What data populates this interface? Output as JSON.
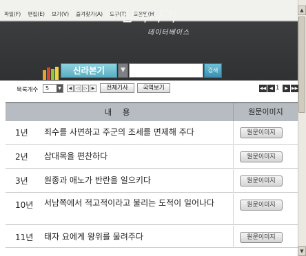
{
  "menubar": {
    "items": [
      "파일(F)",
      "편집(E)",
      "보기(V)",
      "즐겨찾기(A)",
      "도구(T)",
      "도움말(H)"
    ]
  },
  "banner": {
    "title": "삼국사기",
    "subtitle": "데이터베이스"
  },
  "search": {
    "category": "신라본기",
    "value": "",
    "button_label": "검색"
  },
  "toolbar": {
    "count_label": "목록개수",
    "count_value": "5",
    "full_label": "전체기사",
    "translation_label": "국역보기",
    "page": "1"
  },
  "table": {
    "header_content": "내 용",
    "header_image": "원문이미지",
    "image_button_label": "원문이미지",
    "rows": [
      {
        "year": "1년",
        "text": "죄수를 사면하고 주군의 조세를 면제해 주다"
      },
      {
        "year": "2년",
        "text": "삼대목을 편찬하다"
      },
      {
        "year": "3년",
        "text": "원종과 애노가 반란을 일으키다"
      },
      {
        "year": "10년",
        "text": "서남쪽에서 적고적이라고 불리는 도적이 일어나다"
      },
      {
        "year": "11년",
        "text": "태자 요에게 왕위를 물려주다"
      }
    ]
  },
  "colors": {
    "banner": "#2f3133",
    "category": "#59aec2",
    "table_header": "#b6bcc1"
  }
}
